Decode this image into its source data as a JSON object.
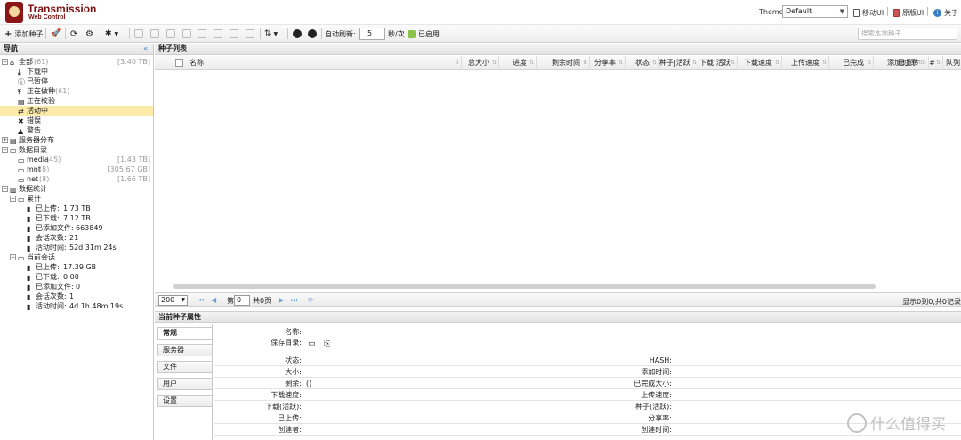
{
  "header": {
    "title": "Transmission",
    "subtitle": "Web Control",
    "theme_label": "Theme:",
    "theme_value": "Default",
    "links": [
      "移动UI",
      "原版UI",
      "关于"
    ]
  },
  "toolbar": {
    "add_label": "添加种子",
    "auto_refresh_label": "自动刷新:",
    "refresh_value": "5",
    "refresh_unit": "秒/次",
    "enabled_label": "已启用",
    "search_placeholder": "搜索本地种子"
  },
  "nav": {
    "title": "导航",
    "collapse": "«",
    "all": {
      "label": "全部",
      "count": "(61)",
      "size": "[3.40 TB]"
    },
    "status": [
      {
        "label": "下载中",
        "icon": "download-icon"
      },
      {
        "label": "已暂停",
        "icon": "pause-icon"
      },
      {
        "label": "正在做种",
        "count": "(61)",
        "icon": "upload-icon"
      },
      {
        "label": "正在校验",
        "icon": "verify-icon"
      },
      {
        "label": "活动中",
        "icon": "active-icon"
      },
      {
        "label": "错误",
        "icon": "error-icon"
      },
      {
        "label": "警告",
        "icon": "warning-icon"
      }
    ],
    "servers": "服务器分布",
    "data_dir": "数据目录",
    "dirs": [
      {
        "label": "media",
        "count": "(45)",
        "size": "[1.43 TB]"
      },
      {
        "label": "mnt",
        "count": "(8)",
        "size": "[305.67 GB]"
      },
      {
        "label": "net",
        "count": "(8)",
        "size": "[1.66 TB]"
      }
    ],
    "stats": "数据统计",
    "cumulative": "累计",
    "cum_items": [
      {
        "label": "已上传:",
        "value": "1.73 TB"
      },
      {
        "label": "已下载:",
        "value": "7.12 TB"
      },
      {
        "label": "已添加文件:",
        "value": "663849"
      },
      {
        "label": "会话次数:",
        "value": "21"
      },
      {
        "label": "活动时间:",
        "value": "52d 31m 24s"
      }
    ],
    "session": "当前会话",
    "ses_items": [
      {
        "label": "已上传:",
        "value": "17.39 GB"
      },
      {
        "label": "已下载:",
        "value": "0.00"
      },
      {
        "label": "已添加文件:",
        "value": "0"
      },
      {
        "label": "会话次数:",
        "value": "1"
      },
      {
        "label": "活动时间:",
        "value": "4d 1h 48m 19s"
      }
    ]
  },
  "list": {
    "title": "种子列表",
    "columns": [
      "名称",
      "总大小",
      "进度",
      "剩余时间",
      "分享率",
      "状态",
      "种子|活跃",
      "下载|活跃",
      "下载速度",
      "上传速度",
      "已完成",
      "已上传",
      "添加时间",
      "#",
      "队列"
    ],
    "page_size": "200",
    "page_prefix": "第",
    "page_value": "0",
    "page_total": "共0页",
    "status_right": "显示0到0,共0记录"
  },
  "props": {
    "title": "当前种子属性",
    "tabs": [
      "常规",
      "服务器",
      "文件",
      "用户",
      "设置"
    ],
    "name_label": "名称:",
    "savedir_label": "保存目录:",
    "left_fields": [
      {
        "label": "状态:",
        "value": ""
      },
      {
        "label": "大小:",
        "value": ""
      },
      {
        "label": "剩余:",
        "value": "()"
      },
      {
        "label": "下载速度:",
        "value": ""
      },
      {
        "label": "下载(活跃):",
        "value": ""
      },
      {
        "label": "已上传:",
        "value": ""
      },
      {
        "label": "创建者:",
        "value": ""
      }
    ],
    "right_fields": [
      {
        "label": "HASH:"
      },
      {
        "label": "添加时间:"
      },
      {
        "label": "已完成大小:"
      },
      {
        "label": "上传速度:"
      },
      {
        "label": "种子(活跃):"
      },
      {
        "label": "分享率:"
      },
      {
        "label": "创建时间:"
      }
    ]
  },
  "watermark": "什么值得买",
  "colors": {
    "accent": "#3b7fc4",
    "selected": "#fbeaa8",
    "brand": "#7a0f0f"
  }
}
